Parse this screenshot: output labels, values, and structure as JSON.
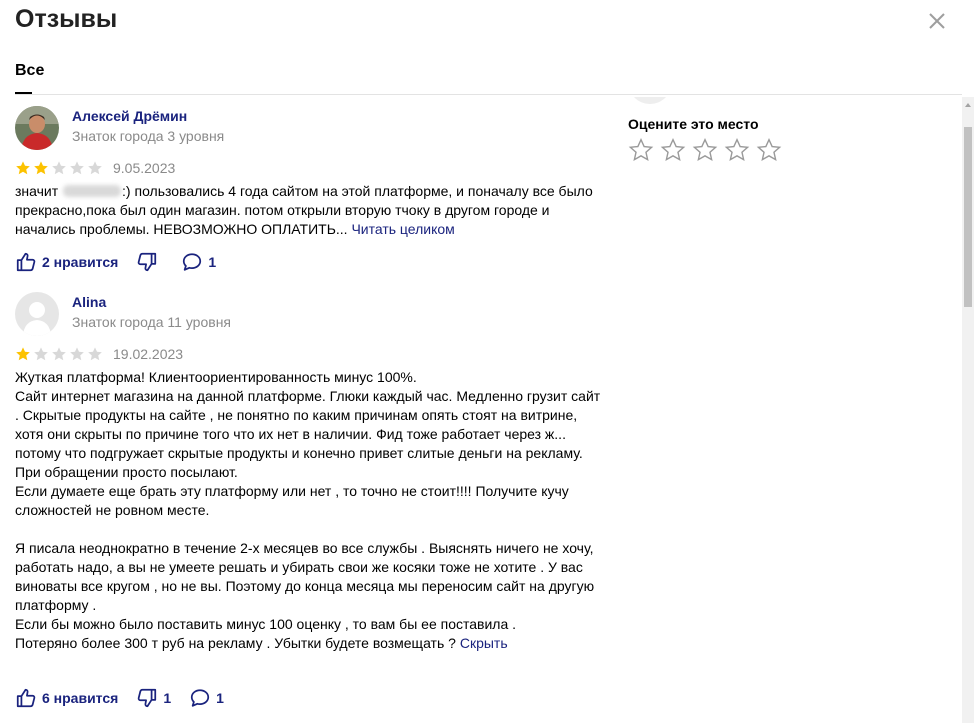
{
  "header": {
    "title": "Отзывы"
  },
  "tabs": [
    {
      "label": "Все"
    }
  ],
  "rate": {
    "label": "Оцените это место"
  },
  "reviews": [
    {
      "author": "Алексей Дрёмин",
      "level": "Знаток города 3 уровня",
      "rating": 2,
      "date": "9.05.2023",
      "text_before": "значит ",
      "text_after": ":) пользовались 4 года сайтом на этой платформе, и поначалу все было прекрасно,пока был один магазин. потом открыли вторую тчоку в другом городе и начались проблемы. НЕВОЗМОЖНО ОПЛАТИТЬ... ",
      "more_link": "Читать целиком",
      "likes": "2 нравится",
      "dislikes": "",
      "comments": "1"
    },
    {
      "author": "Alina",
      "level": "Знаток города 11 уровня",
      "rating": 1,
      "date": "19.02.2023",
      "text": "Жуткая платформа! Клиентоориентированность минус 100%.\nСайт интернет магазина на данной платформе. Глюки каждый час. Медленно грузит сайт . Скрытые продукты на сайте , не понятно по каким причинам опять стоят на витрине, хотя они скрыты по причине того что их нет в наличии. Фид тоже работает через ж... потому что подгружает скрытые продукты и конечно привет слитые деньги на рекламу.\nПри обращении просто посылают.\nЕсли думаете еще брать эту платформу или нет , то точно не стоит!!!! Получите кучу сложностей не ровном месте.\n\nЯ писала неоднократно в течение 2-х месяцев во все службы . Выяснять ничего не хочу, работать надо, а вы не умеете решать и убирать свои же косяки тоже не хотите . У вас виноваты все кругом , но не вы. Поэтому до конца месяца мы переносим сайт на другую платформу .\nЕсли бы можно было поставить минус 100 оценку , то вам бы ее поставила .\nПотеряно более 300 т руб на рекламу . Убытки будете возмещать ? ",
      "hide_link": "Скрыть",
      "likes": "6 нравится",
      "dislikes": "1",
      "comments": "1"
    }
  ],
  "colors": {
    "star_filled": "#fcc200",
    "star_empty": "#d8d8d8",
    "link": "#1a237e",
    "muted": "#8a8a8a"
  }
}
